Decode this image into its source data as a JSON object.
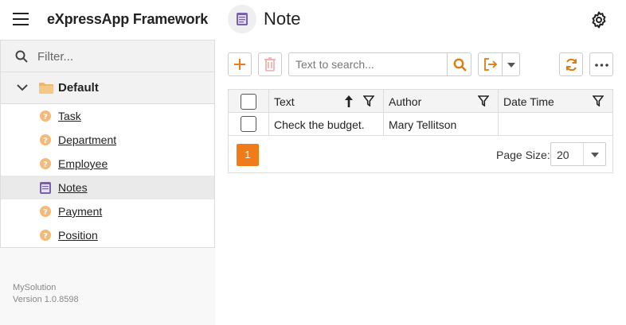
{
  "header": {
    "app_title": "eXpressApp Framework",
    "view_title": "Note"
  },
  "sidebar": {
    "filter_placeholder": "Filter...",
    "group": "Default",
    "items": [
      {
        "label": "Task",
        "icon": "question-icon"
      },
      {
        "label": "Department",
        "icon": "question-icon"
      },
      {
        "label": "Employee",
        "icon": "question-icon"
      },
      {
        "label": "Notes",
        "icon": "note-icon",
        "selected": true
      },
      {
        "label": "Payment",
        "icon": "question-icon"
      },
      {
        "label": "Position",
        "icon": "question-icon"
      }
    ],
    "footer_app": "MySolution",
    "footer_version": "Version 1.0.8598"
  },
  "toolbar": {
    "search_placeholder": "Text to search..."
  },
  "grid": {
    "columns": [
      "Text",
      "Author",
      "Date Time"
    ],
    "rows": [
      {
        "text": "Check the budget.",
        "author": "Mary Tellitson",
        "date_time": ""
      }
    ],
    "current_page": "1",
    "page_size_label": "Page Size:",
    "page_size": "20"
  },
  "colors": {
    "accent": "#f07b1a",
    "delete_disabled": "#f0a8a8",
    "note_icon": "#7a5fb0"
  }
}
